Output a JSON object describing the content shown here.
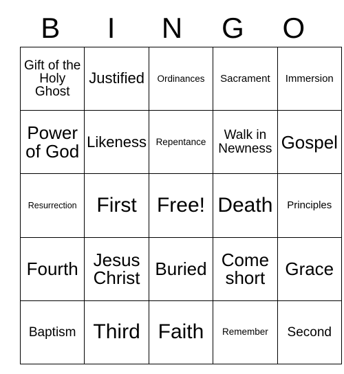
{
  "card": {
    "header_letters": [
      "B",
      "I",
      "N",
      "G",
      "O"
    ],
    "rows": [
      [
        {
          "label": "Gift of the Holy Ghost",
          "size": "fs-m"
        },
        {
          "label": "Justified",
          "size": "fs-l"
        },
        {
          "label": "Ordinances",
          "size": "fs-xs"
        },
        {
          "label": "Sacrament",
          "size": "fs-s"
        },
        {
          "label": "Immersion",
          "size": "fs-s"
        }
      ],
      [
        {
          "label": "Power of God",
          "size": "fs-xl"
        },
        {
          "label": "Likeness",
          "size": "fs-l"
        },
        {
          "label": "Repentance",
          "size": "fs-xs"
        },
        {
          "label": "Walk in Newness",
          "size": "fs-m"
        },
        {
          "label": "Gospel",
          "size": "fs-xl"
        }
      ],
      [
        {
          "label": "Resurrection",
          "size": "fs-xxs"
        },
        {
          "label": "First",
          "size": "fs-xxl"
        },
        {
          "label": "Free!",
          "size": "fs-xxl"
        },
        {
          "label": "Death",
          "size": "fs-xxl"
        },
        {
          "label": "Principles",
          "size": "fs-s"
        }
      ],
      [
        {
          "label": "Fourth",
          "size": "fs-xl"
        },
        {
          "label": "Jesus Christ",
          "size": "fs-xl"
        },
        {
          "label": "Buried",
          "size": "fs-xl"
        },
        {
          "label": "Come short",
          "size": "fs-xl"
        },
        {
          "label": "Grace",
          "size": "fs-xl"
        }
      ],
      [
        {
          "label": "Baptism",
          "size": "fs-m"
        },
        {
          "label": "Third",
          "size": "fs-xxl"
        },
        {
          "label": "Faith",
          "size": "fs-xxl"
        },
        {
          "label": "Remember",
          "size": "fs-xs"
        },
        {
          "label": "Second",
          "size": "fs-m"
        }
      ]
    ],
    "free_space": {
      "row": 2,
      "column": 2,
      "label": "Free!"
    },
    "colors": {
      "background": "#ffffff",
      "text": "#000000",
      "grid_line": "#000000"
    }
  }
}
